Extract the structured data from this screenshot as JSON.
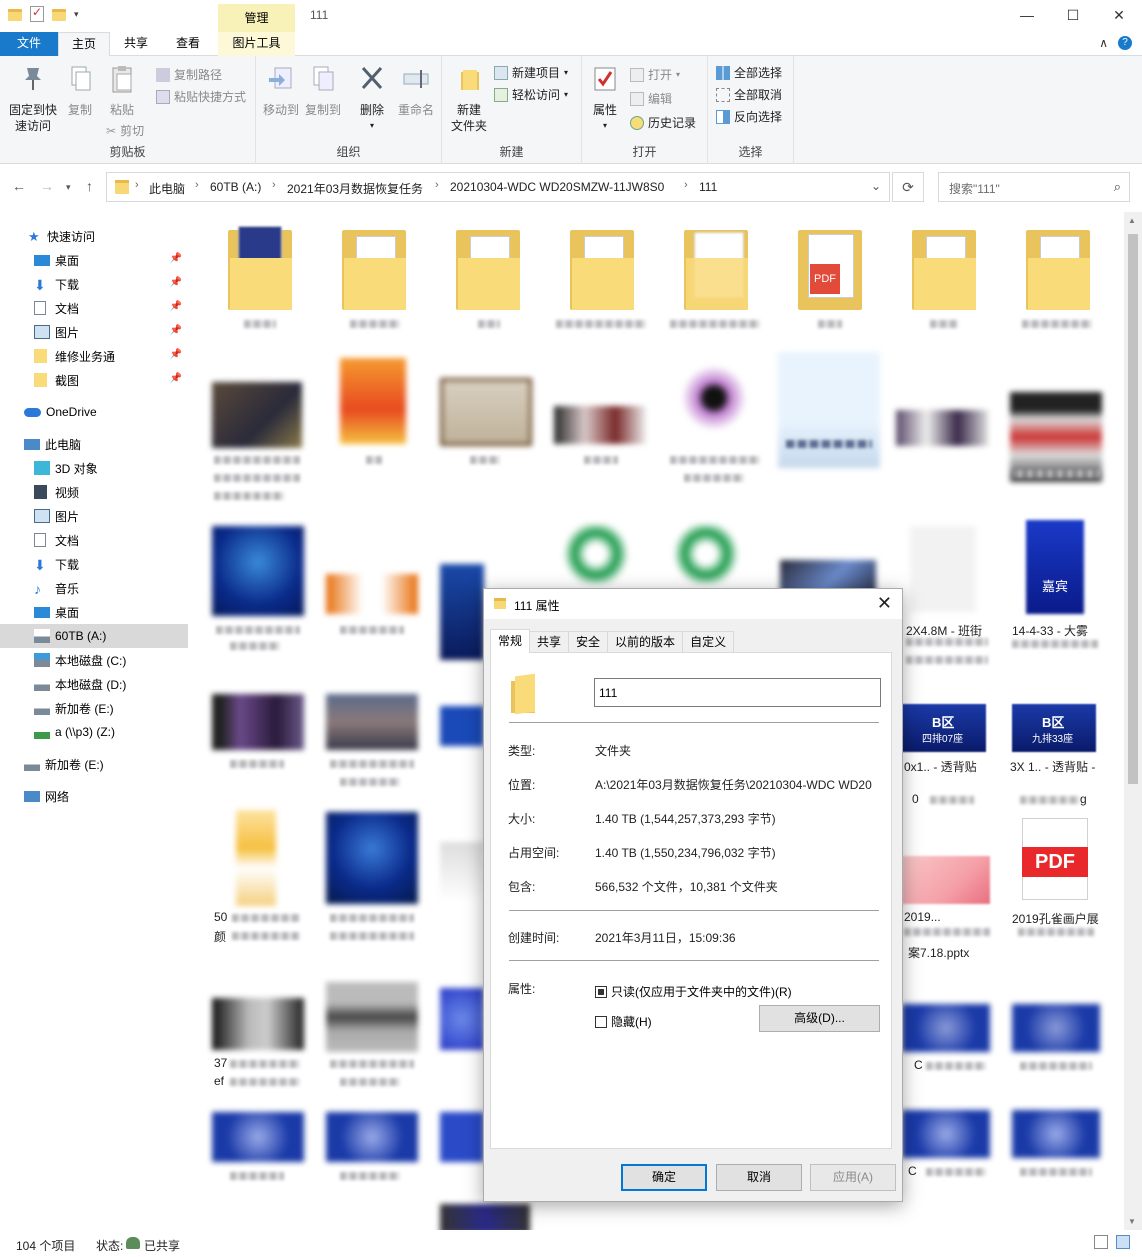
{
  "window": {
    "title": "111",
    "manage_tab": "管理",
    "minimize": "—",
    "maximize": "☐",
    "close": "✕"
  },
  "ribbon_tabs": {
    "file": "文件",
    "home": "主页",
    "share": "共享",
    "view": "查看",
    "picture_tools": "图片工具",
    "collapse": "∧",
    "help": "?"
  },
  "ribbon": {
    "clipboard": {
      "group": "剪贴板",
      "pin_line1": "固定到快",
      "pin_line2": "速访问",
      "copy": "复制",
      "paste": "粘贴",
      "copy_path": "复制路径",
      "paste_shortcut": "粘贴快捷方式",
      "cut": "剪切"
    },
    "organize": {
      "group": "组织",
      "move_to": "移动到",
      "copy_to": "复制到",
      "delete": "删除",
      "rename": "重命名"
    },
    "new": {
      "group": "新建",
      "new_folder_line1": "新建",
      "new_folder_line2": "文件夹",
      "new_item": "新建项目",
      "easy_access": "轻松访问"
    },
    "open": {
      "group": "打开",
      "properties": "属性",
      "open": "打开",
      "edit": "编辑",
      "history": "历史记录"
    },
    "select": {
      "group": "选择",
      "select_all": "全部选择",
      "select_none": "全部取消",
      "invert": "反向选择"
    }
  },
  "address": {
    "crumbs": [
      "此电脑",
      "60TB (A:)",
      "2021年03月数据恢复任务",
      "20210304-WDC WD20SMZW-11JW8S0",
      "111"
    ],
    "search_placeholder": "搜索\"111\""
  },
  "nav": {
    "quick_access": "快速访问",
    "quick_items": [
      "桌面",
      "下载",
      "文档",
      "图片",
      "维修业务通",
      "截图"
    ],
    "onedrive": "OneDrive",
    "this_pc": "此电脑",
    "pc_items": [
      "3D 对象",
      "视频",
      "图片",
      "文档",
      "下载",
      "音乐",
      "桌面",
      "60TB (A:)",
      "本地磁盘 (C:)",
      "本地磁盘 (D:)",
      "新加卷 (E:)",
      "a (\\\\p3) (Z:)"
    ],
    "extra_drive": "新加卷 (E:)",
    "network": "网络"
  },
  "content_visible_text": {
    "t1": "2X4.8M - 班街",
    "t2": "14-4-33 - 大雾",
    "t3": "B区",
    "t4": "四排07座",
    "t5": "B区",
    "t6": "九排33座",
    "t7": "0x1.. - 透背贴",
    "t8": "3X 1.. - 透背贴 -",
    "t9": "0",
    "t10": "g",
    "t11": "50",
    "t12": "颜",
    "t13": "2019...",
    "t14": "2019孔雀画户展",
    "t15": "案7.18.pptx",
    "t16": "37",
    "t17": "ef",
    "t18": "C",
    "t19": "C",
    "t20": "PDF",
    "t21": "PDF",
    "t22": "嘉宾"
  },
  "status": {
    "count": "104 个项目",
    "state_label": "状态:",
    "state_value": "已共享"
  },
  "dialog": {
    "title": "111 属性",
    "tabs": [
      "常规",
      "共享",
      "安全",
      "以前的版本",
      "自定义"
    ],
    "name": "111",
    "type_label": "类型:",
    "type_value": "文件夹",
    "location_label": "位置:",
    "location_value": "A:\\2021年03月数据恢复任务\\20210304-WDC WD20",
    "size_label": "大小:",
    "size_value": "1.40 TB (1,544,257,373,293 字节)",
    "ondisk_label": "占用空间:",
    "ondisk_value": "1.40 TB (1,550,234,796,032 字节)",
    "contains_label": "包含:",
    "contains_value": "566,532 个文件，10,381 个文件夹",
    "created_label": "创建时间:",
    "created_value": "2021年3月11日，15:09:36",
    "attributes_label": "属性:",
    "readonly": "只读(仅应用于文件夹中的文件)(R)",
    "hidden": "隐藏(H)",
    "advanced": "高级(D)...",
    "ok": "确定",
    "cancel": "取消",
    "apply": "应用(A)"
  }
}
